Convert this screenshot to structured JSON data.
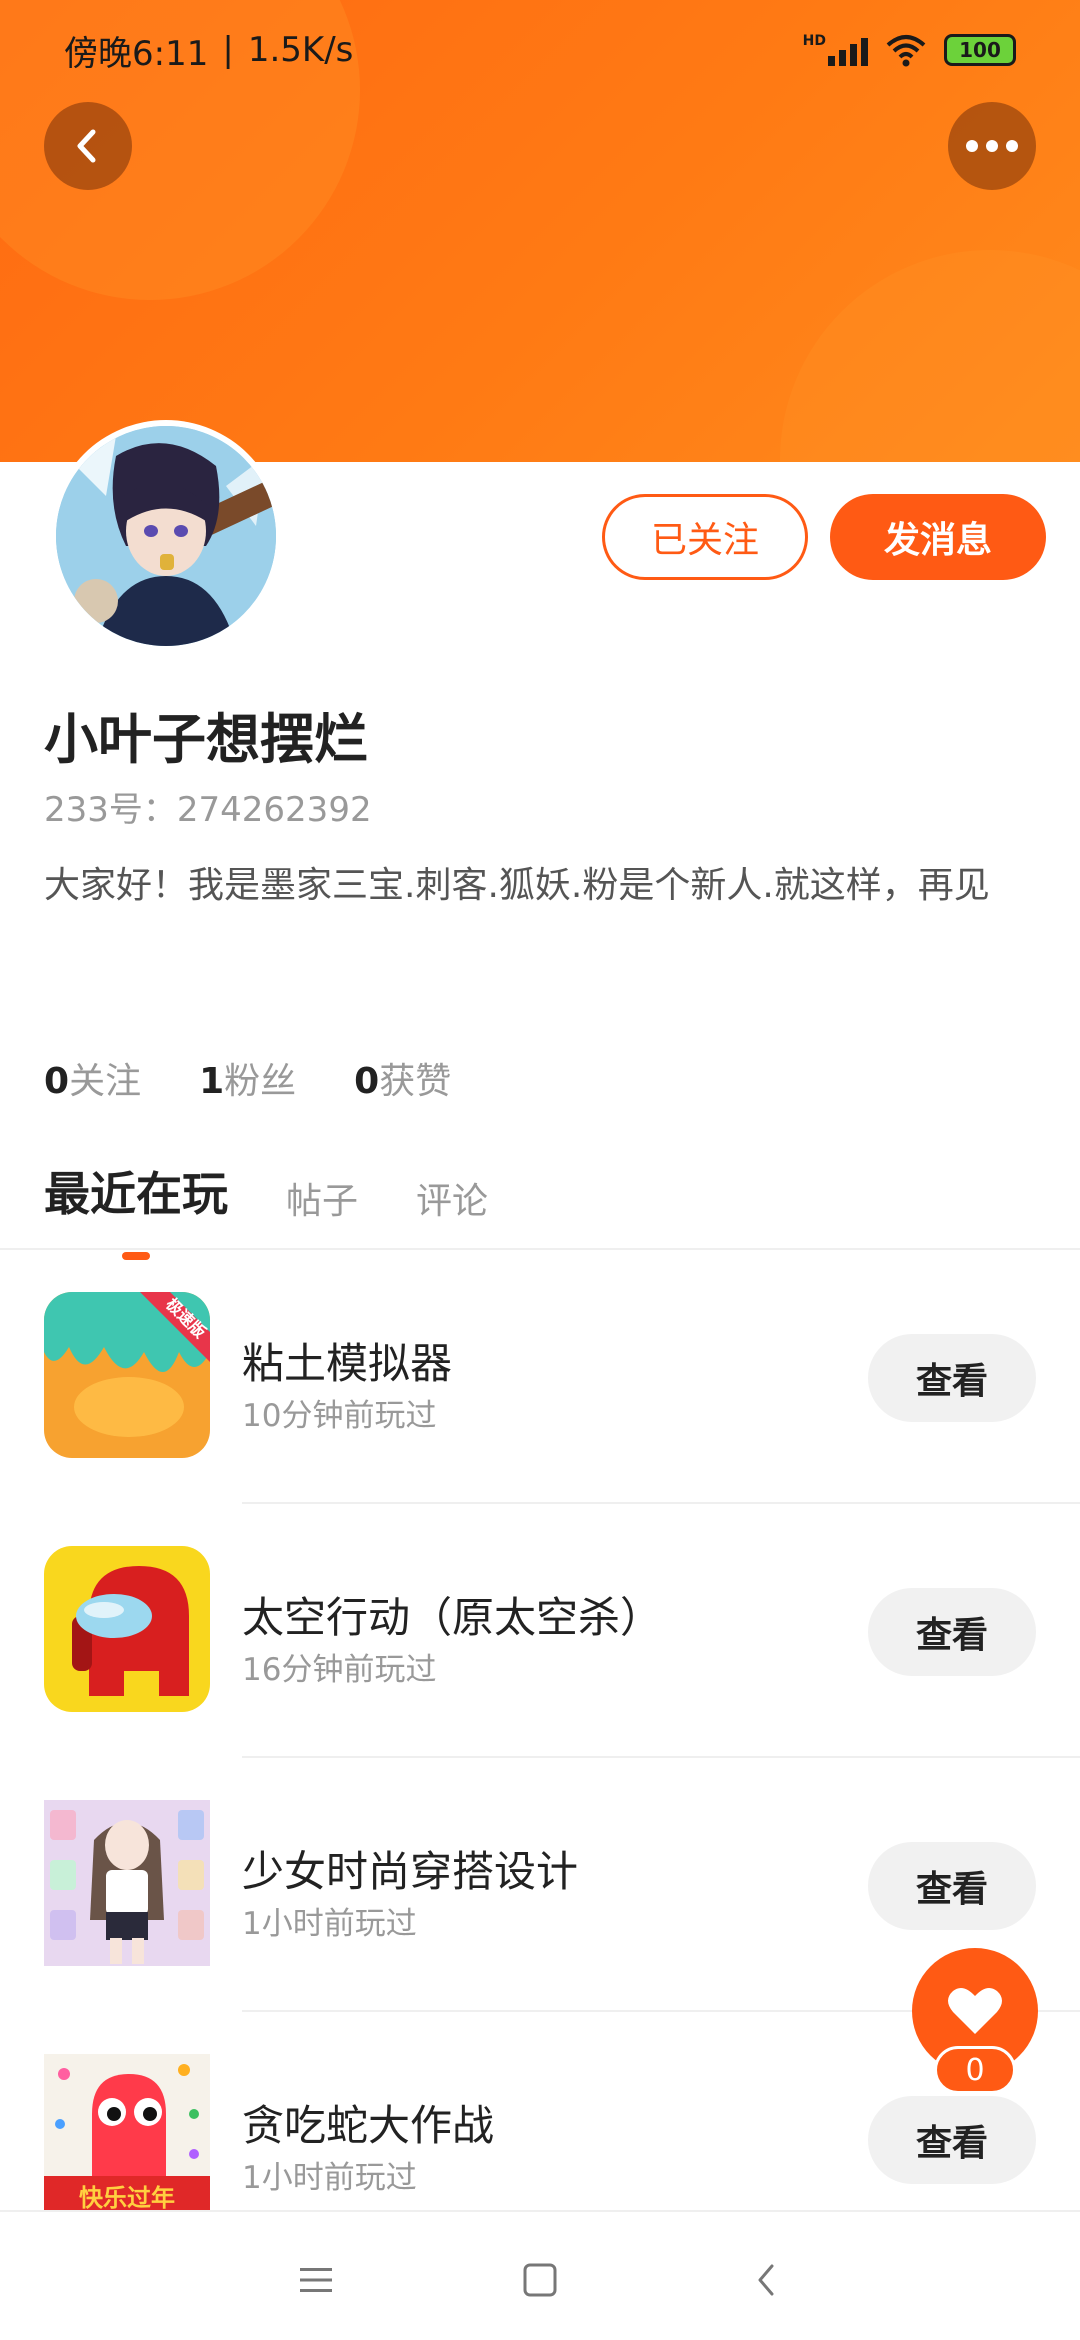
{
  "status_bar": {
    "time": "傍晚6:11",
    "separator": "|",
    "speed": "1.5K/s",
    "network": "HD",
    "battery": "100"
  },
  "header": {
    "back_icon": "chevron-left-icon",
    "more_icon": "more-dots-icon"
  },
  "profile": {
    "nickname": "小叶子想摆烂",
    "uid": "233号：274262392",
    "bio": "大家好！我是墨家三宝.刺客.狐妖.粉是个新人.就这样，再见",
    "followed_label": "已关注",
    "message_label": "发消息",
    "stats": [
      {
        "value": "0",
        "label": "关注"
      },
      {
        "value": "1",
        "label": "粉丝"
      },
      {
        "value": "0",
        "label": "获赞"
      }
    ]
  },
  "tabs": [
    {
      "label": "最近在玩",
      "active": true
    },
    {
      "label": "帖子",
      "active": false
    },
    {
      "label": "评论",
      "active": false
    }
  ],
  "games": [
    {
      "title": "粘土模拟器",
      "time": "10分钟前玩过",
      "action": "查看",
      "badge": "极速版"
    },
    {
      "title": "太空行动（原太空杀）",
      "time": "16分钟前玩过",
      "action": "查看"
    },
    {
      "title": "少女时尚穿搭设计",
      "time": "1小时前玩过",
      "action": "查看"
    },
    {
      "title": "贪吃蛇大作战",
      "time": "1小时前玩过",
      "action": "查看",
      "banner": "快乐过年"
    }
  ],
  "like": {
    "count": "0"
  },
  "colors": {
    "accent": "#ff5a14",
    "banner": "#ff7a14"
  }
}
